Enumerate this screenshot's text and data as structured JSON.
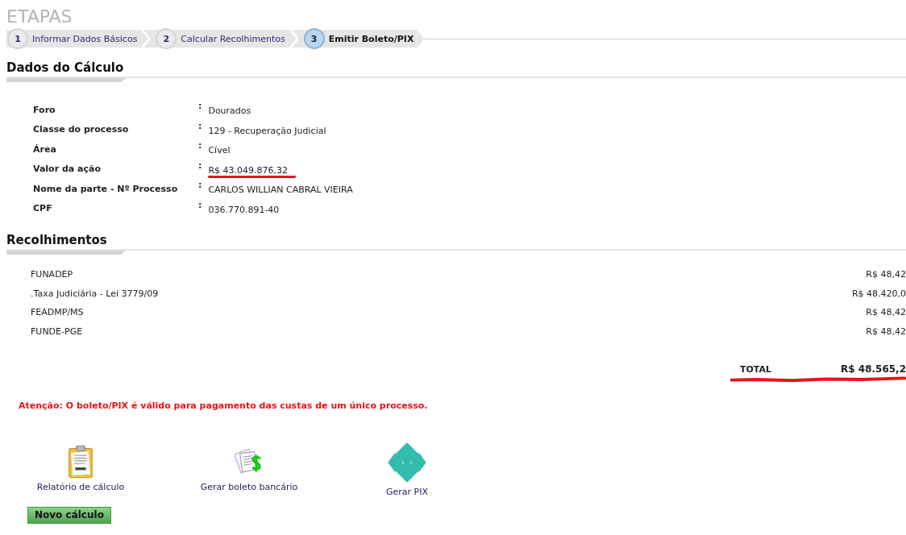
{
  "steps_title": "ETAPAS",
  "steps": [
    {
      "number": "1",
      "label": "Informar Dados Básicos",
      "selected": false
    },
    {
      "number": "2",
      "label": "Calcular Recolhimentos",
      "selected": false
    },
    {
      "number": "3",
      "label": "Emitir Boleto/PIX",
      "selected": true
    }
  ],
  "calculation": {
    "title": "Dados do Cálculo",
    "fields": [
      {
        "label": "Foro",
        "separator": ":",
        "value": "Dourados",
        "marked": false
      },
      {
        "label": "Classe do processo",
        "separator": ":",
        "value": "129 - Recuperação Judicial",
        "marked": false
      },
      {
        "label": "Área",
        "separator": ":",
        "value": "Cível",
        "marked": false
      },
      {
        "label": "Valor da ação",
        "separator": ":",
        "value": "R$ 43.049.876,32",
        "marked": true
      },
      {
        "label": "Nome da parte - Nº Processo",
        "separator": ":",
        "value": "CARLOS WILLIAN CABRAL VIEIRA",
        "marked": false
      },
      {
        "label": "CPF",
        "separator": ":",
        "value": "036.770.891-40",
        "marked": false
      }
    ]
  },
  "fees": {
    "title": "Recolhimentos",
    "rows": [
      {
        "name": "FUNADEP",
        "amount": "R$ 48,42"
      },
      {
        "name": ".Taxa Judiciária - Lei 3779/09",
        "amount": "R$ 48.420,0"
      },
      {
        "name": "FEADMP/MS",
        "amount": "R$ 48,42"
      },
      {
        "name": "FUNDE-PGE",
        "amount": "R$ 48,42"
      }
    ],
    "total_label": "TOTAL",
    "total_amount": "R$ 48.565,2",
    "total_marked": true
  },
  "warning": "Atenção: O boleto/PIX é válido para pagamento das custas de um único processo.",
  "actions": [
    {
      "kind": "report",
      "label": "Relatório de cálculo"
    },
    {
      "kind": "boleto",
      "label": "Gerar boleto bancário"
    },
    {
      "kind": "pix",
      "label": "Gerar PIX"
    }
  ],
  "new_button": "Novo cálculo"
}
